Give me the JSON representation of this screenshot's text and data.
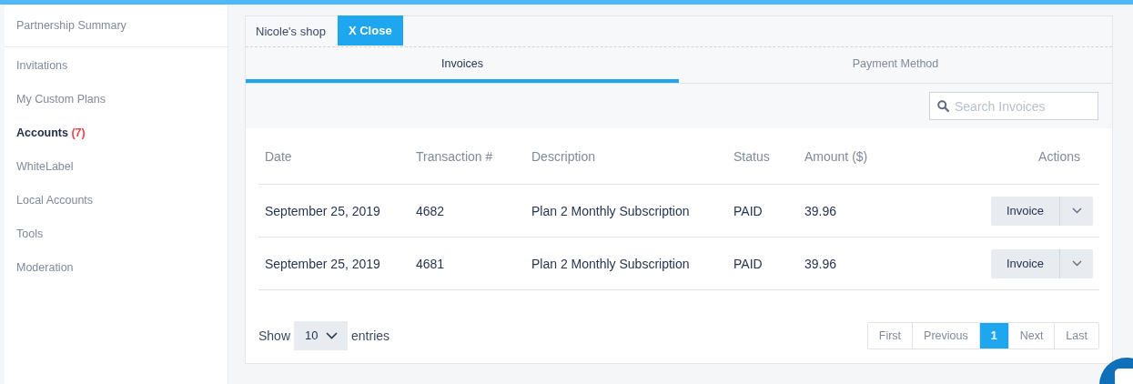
{
  "sidebar": {
    "header": {
      "label": "Partnership Summary",
      "selected": false
    },
    "items": [
      {
        "label": "Invitations",
        "selected": false
      },
      {
        "label": "My Custom Plans",
        "selected": false
      },
      {
        "label": "Accounts",
        "count": "(7)",
        "selected": true
      },
      {
        "label": "WhiteLabel",
        "selected": false
      },
      {
        "label": "Local Accounts",
        "selected": false
      },
      {
        "label": "Tools",
        "selected": false
      },
      {
        "label": "Moderation",
        "selected": false
      }
    ]
  },
  "panel": {
    "shop_name": "Nicole's shop",
    "close_button": "X Close",
    "tabs": [
      {
        "label": "Invoices",
        "selected": true
      },
      {
        "label": "Payment Method",
        "selected": false
      }
    ],
    "search": {
      "placeholder": "Search Invoices"
    },
    "table": {
      "columns": [
        "Date",
        "Transaction #",
        "Description",
        "Status",
        "Amount ($)",
        "Actions"
      ],
      "rows": [
        {
          "cells": [
            "September 25, 2019",
            "4682",
            "Plan 2 Monthly Subscription",
            "PAID",
            "39.96"
          ],
          "action": "Invoice"
        },
        {
          "cells": [
            "September 25, 2019",
            "4681",
            "Plan 2 Monthly Subscription",
            "PAID",
            "39.96"
          ],
          "action": "Invoice"
        }
      ]
    },
    "footer": {
      "show_label": "Show",
      "page_size": "10",
      "entries_label": "entries",
      "pagination": [
        {
          "label": "First",
          "selected": false
        },
        {
          "label": "Previous",
          "selected": false
        },
        {
          "label": "1",
          "selected": true
        },
        {
          "label": "Next",
          "selected": false
        },
        {
          "label": "Last",
          "selected": false
        }
      ]
    }
  }
}
